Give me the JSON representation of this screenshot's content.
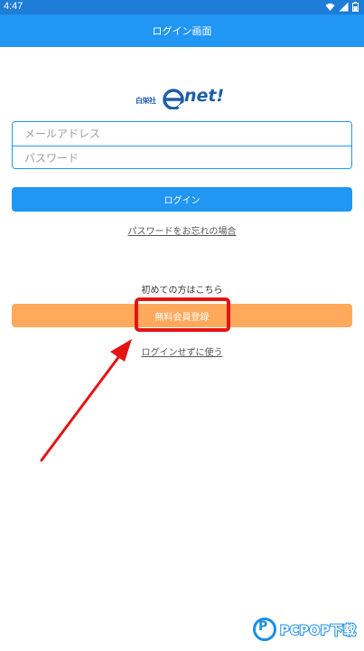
{
  "status_bar": {
    "time": "4:47",
    "icons": [
      "wifi-icon",
      "signal-icon",
      "battery-icon"
    ]
  },
  "app_bar": {
    "title": "ログイン画面"
  },
  "logo": {
    "small_text": "白栄社",
    "brand_text": "net!",
    "brand_color": "#1e5ea8"
  },
  "form": {
    "email_placeholder": "メールアドレス",
    "email_value": "",
    "password_placeholder": "パスワード",
    "password_value": ""
  },
  "buttons": {
    "login_label": "ログイン",
    "register_label": "無料会員登録"
  },
  "links": {
    "forgot_password": "パスワードをお忘れの場合",
    "use_without_login": "ログインせずに使う"
  },
  "first_time_text": "初めての方はこちら",
  "colors": {
    "status_bar": "#1e7dd6",
    "primary": "#2196f3",
    "register": "#ffa95c",
    "annotation": "#e51414"
  },
  "watermark": {
    "text": "PCPOP下载"
  }
}
